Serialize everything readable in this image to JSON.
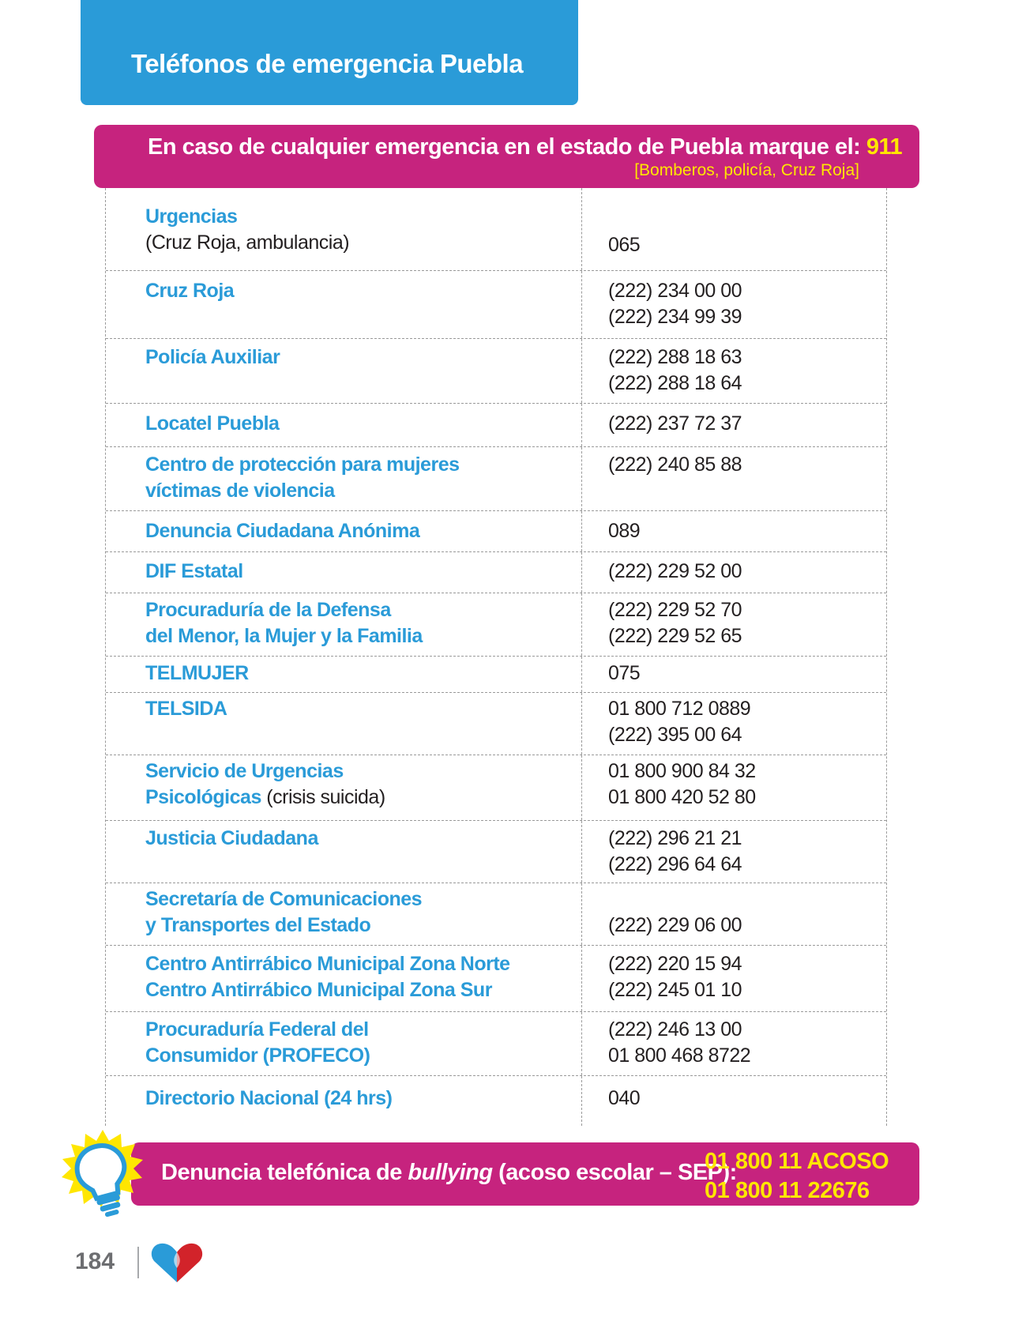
{
  "header": {
    "title": "Teléfonos de emergencia Puebla"
  },
  "top_banner": {
    "text": "En caso de cualquier emergencia en el estado de Puebla marque el: ",
    "number": "911",
    "subtext": "[Bomberos, policía, Cruz Roja]"
  },
  "rows": [
    {
      "name": "Urgencias",
      "sub": "(Cruz Roja, ambulancia)",
      "phones": [
        "065"
      ]
    },
    {
      "name": "Cruz Roja",
      "phones": [
        "(222) 234 00 00",
        "(222) 234 99 39"
      ]
    },
    {
      "name": "Policía Auxiliar",
      "phones": [
        "(222) 288 18 63",
        "(222) 288 18 64"
      ]
    },
    {
      "name": "Locatel Puebla",
      "phones": [
        "(222) 237 72 37"
      ]
    },
    {
      "name": "Centro de protección para mujeres",
      "name2": "víctimas de violencia",
      "phones": [
        "(222) 240 85 88"
      ]
    },
    {
      "name": "Denuncia Ciudadana Anónima",
      "phones": [
        "089"
      ]
    },
    {
      "name": "DIF Estatal",
      "phones": [
        "(222) 229 52 00"
      ]
    },
    {
      "name": "Procuraduría de la Defensa",
      "name2": "del Menor, la Mujer y la Familia",
      "phones": [
        "(222) 229 52 70",
        "(222) 229 52 65"
      ]
    },
    {
      "name": "TELMUJER",
      "phones": [
        "075"
      ]
    },
    {
      "name": "TELSIDA",
      "phones": [
        "01 800 712 0889",
        "(222) 395 00 64"
      ]
    },
    {
      "name": "Servicio de Urgencias",
      "name2": "Psicológicas",
      "note": " (crisis suicida)",
      "phones": [
        "01 800 900 84 32",
        "01 800 420 52 80"
      ]
    },
    {
      "name": "Justicia Ciudadana",
      "phones": [
        "(222) 296 21 21",
        "(222) 296 64 64"
      ]
    },
    {
      "name": "Secretaría de Comunicaciones",
      "name2": "y Transportes del Estado",
      "phones": [
        "(222) 229 06 00"
      ]
    },
    {
      "name": "Centro Antirrábico Municipal Zona Norte",
      "name2": "Centro Antirrábico Municipal Zona Sur",
      "phones": [
        "(222) 220 15 94",
        "(222) 245 01 10"
      ]
    },
    {
      "name": "Procuraduría Federal del",
      "name2": "Consumidor (PROFECO)",
      "phones": [
        "(222) 246 13 00",
        "01 800 468 8722"
      ]
    },
    {
      "name": "Directorio Nacional (24 hrs)",
      "phones": [
        "040"
      ]
    }
  ],
  "bottom_banner": {
    "text_before": "Denuncia telefónica de ",
    "text_italic": "bullying",
    "text_after": " (acoso escolar – SEP):",
    "number1": "01 800 11 ACOSO",
    "number2": "01 800 11 22676"
  },
  "footer": {
    "page_number": "184"
  },
  "colors": {
    "blue": "#2a9bd8",
    "magenta": "#c6237e",
    "yellow": "#ffe600",
    "text": "#231f20"
  },
  "icons": [
    "lightbulb-icon",
    "heart-logo-icon"
  ]
}
